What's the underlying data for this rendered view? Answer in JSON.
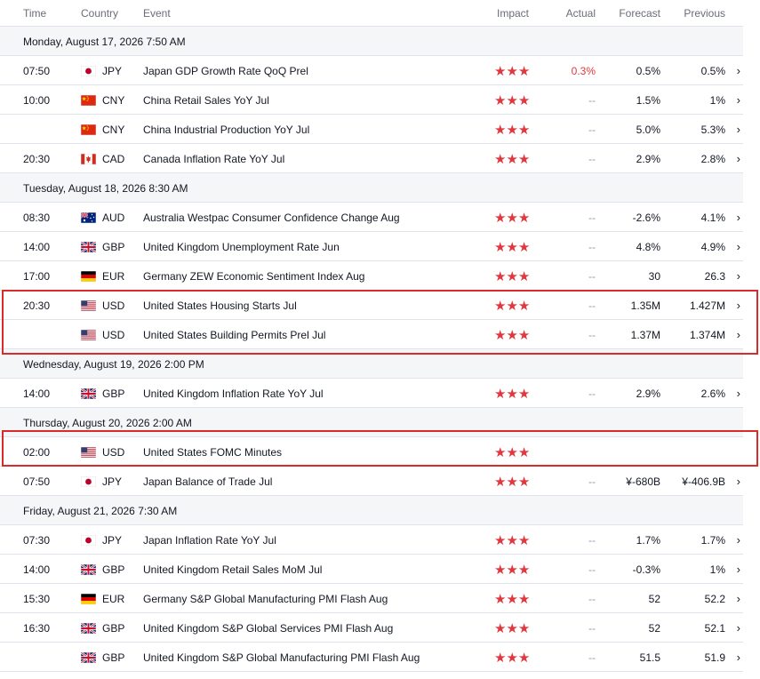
{
  "header": {
    "time": "Time",
    "country": "Country",
    "event": "Event",
    "impact": "Impact",
    "actual": "Actual",
    "forecast": "Forecast",
    "previous": "Previous"
  },
  "days": [
    "Monday, August 17, 2026 7:50 AM",
    "Tuesday, August 18, 2026 8:30 AM",
    "Wednesday, August 19, 2026 2:00 PM",
    "Thursday, August 20, 2026 2:00 AM",
    "Friday, August 21, 2026 7:30 AM"
  ],
  "rows": [
    {
      "time": "07:50",
      "flag": "jp",
      "currency": "JPY",
      "event": "Japan GDP Growth Rate QoQ Prel",
      "impact": "★★★",
      "actual": "0.3%",
      "forecast": "0.5%",
      "previous": "0.5%",
      "chevron": "›"
    },
    {
      "time": "10:00",
      "flag": "cn",
      "currency": "CNY",
      "event": "China Retail Sales YoY Jul",
      "impact": "★★★",
      "actual": "--",
      "forecast": "1.5%",
      "previous": "1%",
      "chevron": "›"
    },
    {
      "time": "",
      "flag": "cn",
      "currency": "CNY",
      "event": "China Industrial Production YoY Jul",
      "impact": "★★★",
      "actual": "--",
      "forecast": "5.0%",
      "previous": "5.3%",
      "chevron": "›"
    },
    {
      "time": "20:30",
      "flag": "ca",
      "currency": "CAD",
      "event": "Canada Inflation Rate YoY Jul",
      "impact": "★★★",
      "actual": "--",
      "forecast": "2.9%",
      "previous": "2.8%",
      "chevron": "›"
    },
    {
      "time": "08:30",
      "flag": "au",
      "currency": "AUD",
      "event": "Australia Westpac Consumer Confidence Change Aug",
      "impact": "★★★",
      "actual": "--",
      "forecast": "-2.6%",
      "previous": "4.1%",
      "chevron": "›"
    },
    {
      "time": "14:00",
      "flag": "gb",
      "currency": "GBP",
      "event": "United Kingdom Unemployment Rate Jun",
      "impact": "★★★",
      "actual": "--",
      "forecast": "4.8%",
      "previous": "4.9%",
      "chevron": "›"
    },
    {
      "time": "17:00",
      "flag": "de",
      "currency": "EUR",
      "event": "Germany ZEW Economic Sentiment Index Aug",
      "impact": "★★★",
      "actual": "--",
      "forecast": "30",
      "previous": "26.3",
      "chevron": "›"
    },
    {
      "time": "20:30",
      "flag": "us",
      "currency": "USD",
      "event": "United States Housing Starts Jul",
      "impact": "★★★",
      "actual": "--",
      "forecast": "1.35M",
      "previous": "1.427M",
      "chevron": "›"
    },
    {
      "time": "",
      "flag": "us",
      "currency": "USD",
      "event": "United States Building Permits Prel Jul",
      "impact": "★★★",
      "actual": "--",
      "forecast": "1.37M",
      "previous": "1.374M",
      "chevron": "›"
    },
    {
      "time": "14:00",
      "flag": "gb",
      "currency": "GBP",
      "event": "United Kingdom Inflation Rate YoY Jul",
      "impact": "★★★",
      "actual": "--",
      "forecast": "2.9%",
      "previous": "2.6%",
      "chevron": "›"
    },
    {
      "time": "02:00",
      "flag": "us",
      "currency": "USD",
      "event": "United States FOMC Minutes",
      "impact": "★★★",
      "actual": "",
      "forecast": "",
      "previous": "",
      "chevron": ""
    },
    {
      "time": "07:50",
      "flag": "jp",
      "currency": "JPY",
      "event": "Japan Balance of Trade Jul",
      "impact": "★★★",
      "actual": "--",
      "forecast": "¥-680B",
      "previous": "¥-406.9B",
      "chevron": "›"
    },
    {
      "time": "07:30",
      "flag": "jp",
      "currency": "JPY",
      "event": "Japan Inflation Rate YoY Jul",
      "impact": "★★★",
      "actual": "--",
      "forecast": "1.7%",
      "previous": "1.7%",
      "chevron": "›"
    },
    {
      "time": "14:00",
      "flag": "gb",
      "currency": "GBP",
      "event": "United Kingdom Retail Sales MoM Jul",
      "impact": "★★★",
      "actual": "--",
      "forecast": "-0.3%",
      "previous": "1%",
      "chevron": "›"
    },
    {
      "time": "15:30",
      "flag": "de",
      "currency": "EUR",
      "event": "Germany S&P Global Manufacturing PMI Flash Aug",
      "impact": "★★★",
      "actual": "--",
      "forecast": "52",
      "previous": "52.2",
      "chevron": "›"
    },
    {
      "time": "16:30",
      "flag": "gb",
      "currency": "GBP",
      "event": "United Kingdom S&P Global Services PMI Flash Aug",
      "impact": "★★★",
      "actual": "--",
      "forecast": "52",
      "previous": "52.1",
      "chevron": "›"
    },
    {
      "time": "",
      "flag": "gb",
      "currency": "GBP",
      "event": "United Kingdom S&P Global Manufacturing PMI Flash Aug",
      "impact": "★★★",
      "actual": "--",
      "forecast": "51.5",
      "previous": "51.9",
      "chevron": "›"
    }
  ],
  "colors": {
    "impact": "#e0383e",
    "actual_miss": "#e0383e",
    "highlight": "#d92b2b"
  }
}
